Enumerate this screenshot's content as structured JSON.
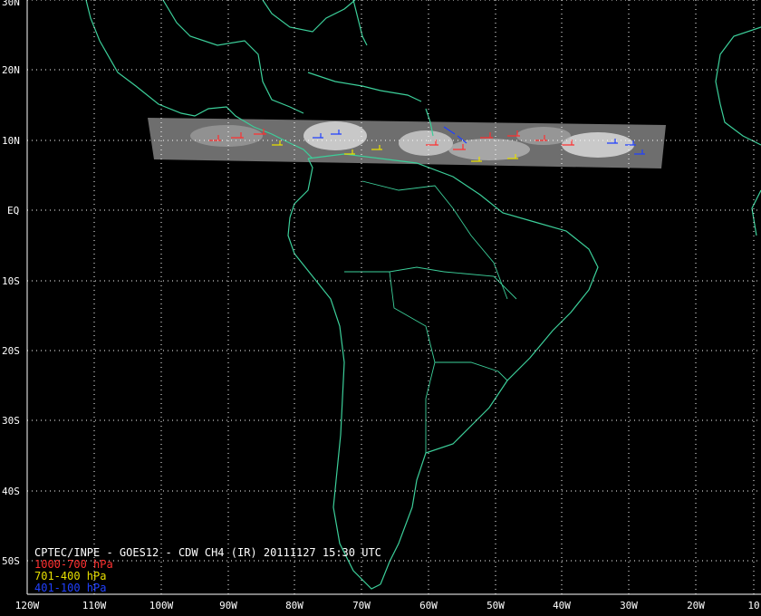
{
  "map": {
    "title": "CPTEC/INPE - GOES12 - CDW CH4 (IR) 20111127 15:30 UTC",
    "legend": [
      {
        "label": "1000-700 hPa",
        "color": "#ff3030"
      },
      {
        "label": "701-400 hPa",
        "color": "#e8e000"
      },
      {
        "label": "401-100 hPa",
        "color": "#2040ff"
      }
    ],
    "lat_labels": [
      "30N",
      "20N",
      "10N",
      "EQ",
      "10S",
      "20S",
      "30S",
      "40S",
      "50S"
    ],
    "lon_labels": [
      "120W",
      "110W",
      "100W",
      "90W",
      "80W",
      "70W",
      "60W",
      "50W",
      "40W",
      "30W",
      "20W",
      "10"
    ],
    "coast_color": "#3ccf9a",
    "grid_color": "#ffffff",
    "background": "#000000"
  }
}
